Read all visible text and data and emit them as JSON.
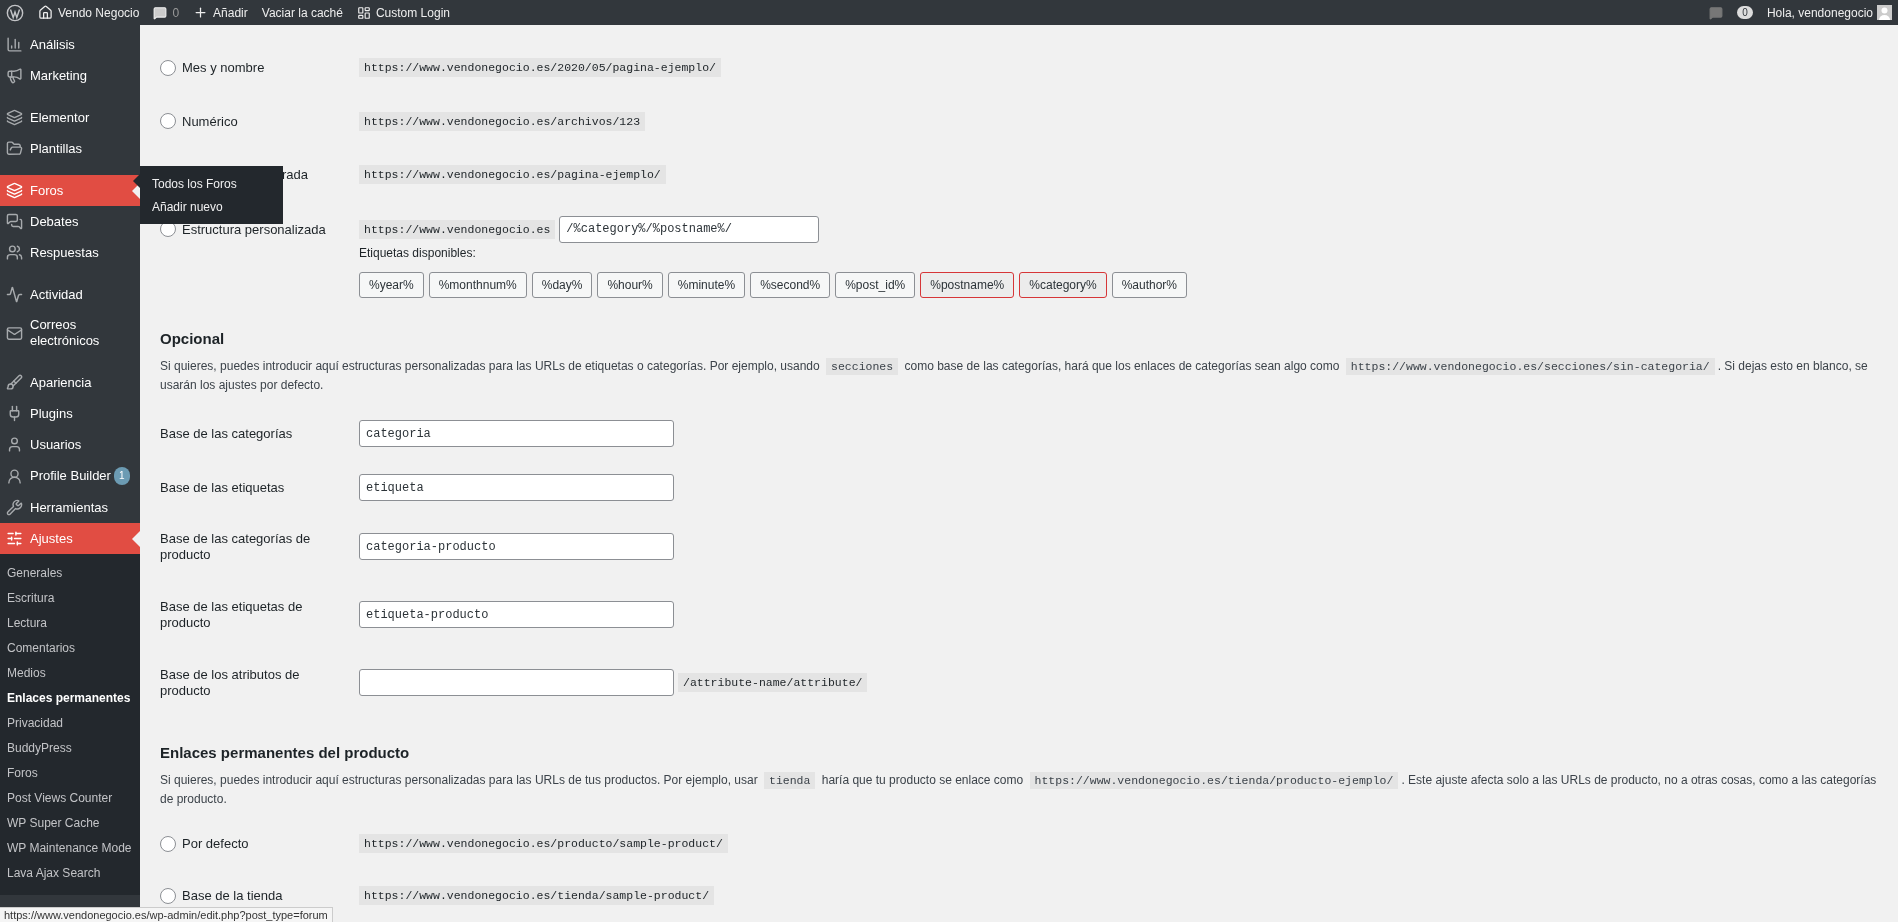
{
  "admin_bar": {
    "site": "Vendo Negocio",
    "comments": "0",
    "new": "Añadir",
    "cache": "Vaciar la caché",
    "custom_login": "Custom Login",
    "notifications": "0",
    "greeting": "Hola, vendonegocio"
  },
  "sidebar": {
    "menu": [
      {
        "label": "Análisis",
        "selected": false
      },
      {
        "label": "Marketing",
        "selected": false
      },
      {
        "label": "Elementor",
        "selected": false
      },
      {
        "label": "Plantillas",
        "selected": false
      },
      {
        "label": "Foros",
        "selected": true
      },
      {
        "label": "Debates",
        "selected": false
      },
      {
        "label": "Respuestas",
        "selected": false
      },
      {
        "label": "Actividad",
        "selected": false
      },
      {
        "label": "Correos electrónicos",
        "selected": false
      },
      {
        "label": "Apariencia",
        "selected": false
      },
      {
        "label": "Plugins",
        "selected": false
      },
      {
        "label": "Usuarios",
        "selected": false
      },
      {
        "label": "Profile Builder",
        "selected": false,
        "badge": "1"
      },
      {
        "label": "Herramientas",
        "selected": false
      },
      {
        "label": "Ajustes",
        "selected": true
      }
    ],
    "submenu": [
      {
        "label": "Generales",
        "selected": false
      },
      {
        "label": "Escritura",
        "selected": false
      },
      {
        "label": "Lectura",
        "selected": false
      },
      {
        "label": "Comentarios",
        "selected": false
      },
      {
        "label": "Medios",
        "selected": false
      },
      {
        "label": "Enlaces permanentes",
        "selected": true
      },
      {
        "label": "Privacidad",
        "selected": false
      },
      {
        "label": "BuddyPress",
        "selected": false
      },
      {
        "label": "Foros",
        "selected": false
      },
      {
        "label": "Post Views Counter",
        "selected": false
      },
      {
        "label": "WP Super Cache",
        "selected": false
      },
      {
        "label": "WP Maintenance Mode",
        "selected": false
      },
      {
        "label": "Lava Ajax Search",
        "selected": false
      }
    ]
  },
  "flyout": {
    "items": [
      "Todos los Foros",
      "Añadir nuevo"
    ]
  },
  "permalink_rows": [
    {
      "kind": "plain",
      "label": "Mes y nombre",
      "example": "https://www.vendonegocio.es/2020/05/pagina-ejemplo/",
      "selected": false
    },
    {
      "kind": "plain",
      "label": "Numérico",
      "example": "https://www.vendonegocio.es/archivos/123",
      "selected": false
    },
    {
      "kind": "covered",
      "label": "rada",
      "example": "https://www.vendonegocio.es/pagina-ejemplo/"
    },
    {
      "kind": "custom",
      "label": "Estructura personalizada",
      "example": "https://www.vendonegocio.es",
      "value": "/%category%/%postname%/",
      "selected": false
    }
  ],
  "available_tags": {
    "label": "Etiquetas disponibles:",
    "tags": [
      {
        "label": "%year%",
        "active": false
      },
      {
        "label": "%monthnum%",
        "active": false
      },
      {
        "label": "%day%",
        "active": false
      },
      {
        "label": "%hour%",
        "active": false
      },
      {
        "label": "%minute%",
        "active": false
      },
      {
        "label": "%second%",
        "active": false
      },
      {
        "label": "%post_id%",
        "active": false
      },
      {
        "label": "%postname%",
        "active": true
      },
      {
        "label": "%category%",
        "active": true
      },
      {
        "label": "%author%",
        "active": false
      }
    ]
  },
  "optional": {
    "heading": "Opcional",
    "description": [
      "Si quieres, puedes introducir aquí estructuras personalizadas para las URLs de etiquetas o categorías. Por ejemplo, usando ",
      "secciones",
      " como base de las categorías, hará que los enlaces de categorías sean algo como ",
      "https://www.vendonegocio.es/secciones/sin-categoria/",
      ". Si dejas esto en blanco, se usarán los ajustes por defecto."
    ],
    "fields": [
      {
        "label": "Base de las categorías",
        "value": "categoria"
      },
      {
        "label": "Base de las etiquetas",
        "value": "etiqueta"
      },
      {
        "label": "Base de las categorías de producto",
        "value": "categoria-producto"
      },
      {
        "label": "Base de las etiquetas de producto",
        "value": "etiqueta-producto"
      },
      {
        "label": "Base de los atributos de producto",
        "suffix": "/attribute-name/attribute/"
      }
    ]
  },
  "product_permalinks": {
    "heading": "Enlaces permanentes del producto",
    "description": [
      "Si quieres, puedes introducir aquí estructuras personalizadas para las URLs de tus productos. Por ejemplo, usar ",
      "tienda",
      " haría que tu producto se enlace como ",
      "https://www.vendonegocio.es/tienda/producto-ejemplo/",
      ". Este ajuste afecta solo a las URLs de producto, no a otras cosas, como a las categorías de producto."
    ],
    "rows": [
      {
        "label": "Por defecto",
        "example": "https://www.vendonegocio.es/producto/sample-product/",
        "selected": false
      },
      {
        "label": "Base de la tienda",
        "example": "https://www.vendonegocio.es/tienda/sample-product/",
        "selected": false
      }
    ]
  },
  "status_url": "https://www.vendonegocio.es/wp-admin/edit.php?post_type=forum"
}
